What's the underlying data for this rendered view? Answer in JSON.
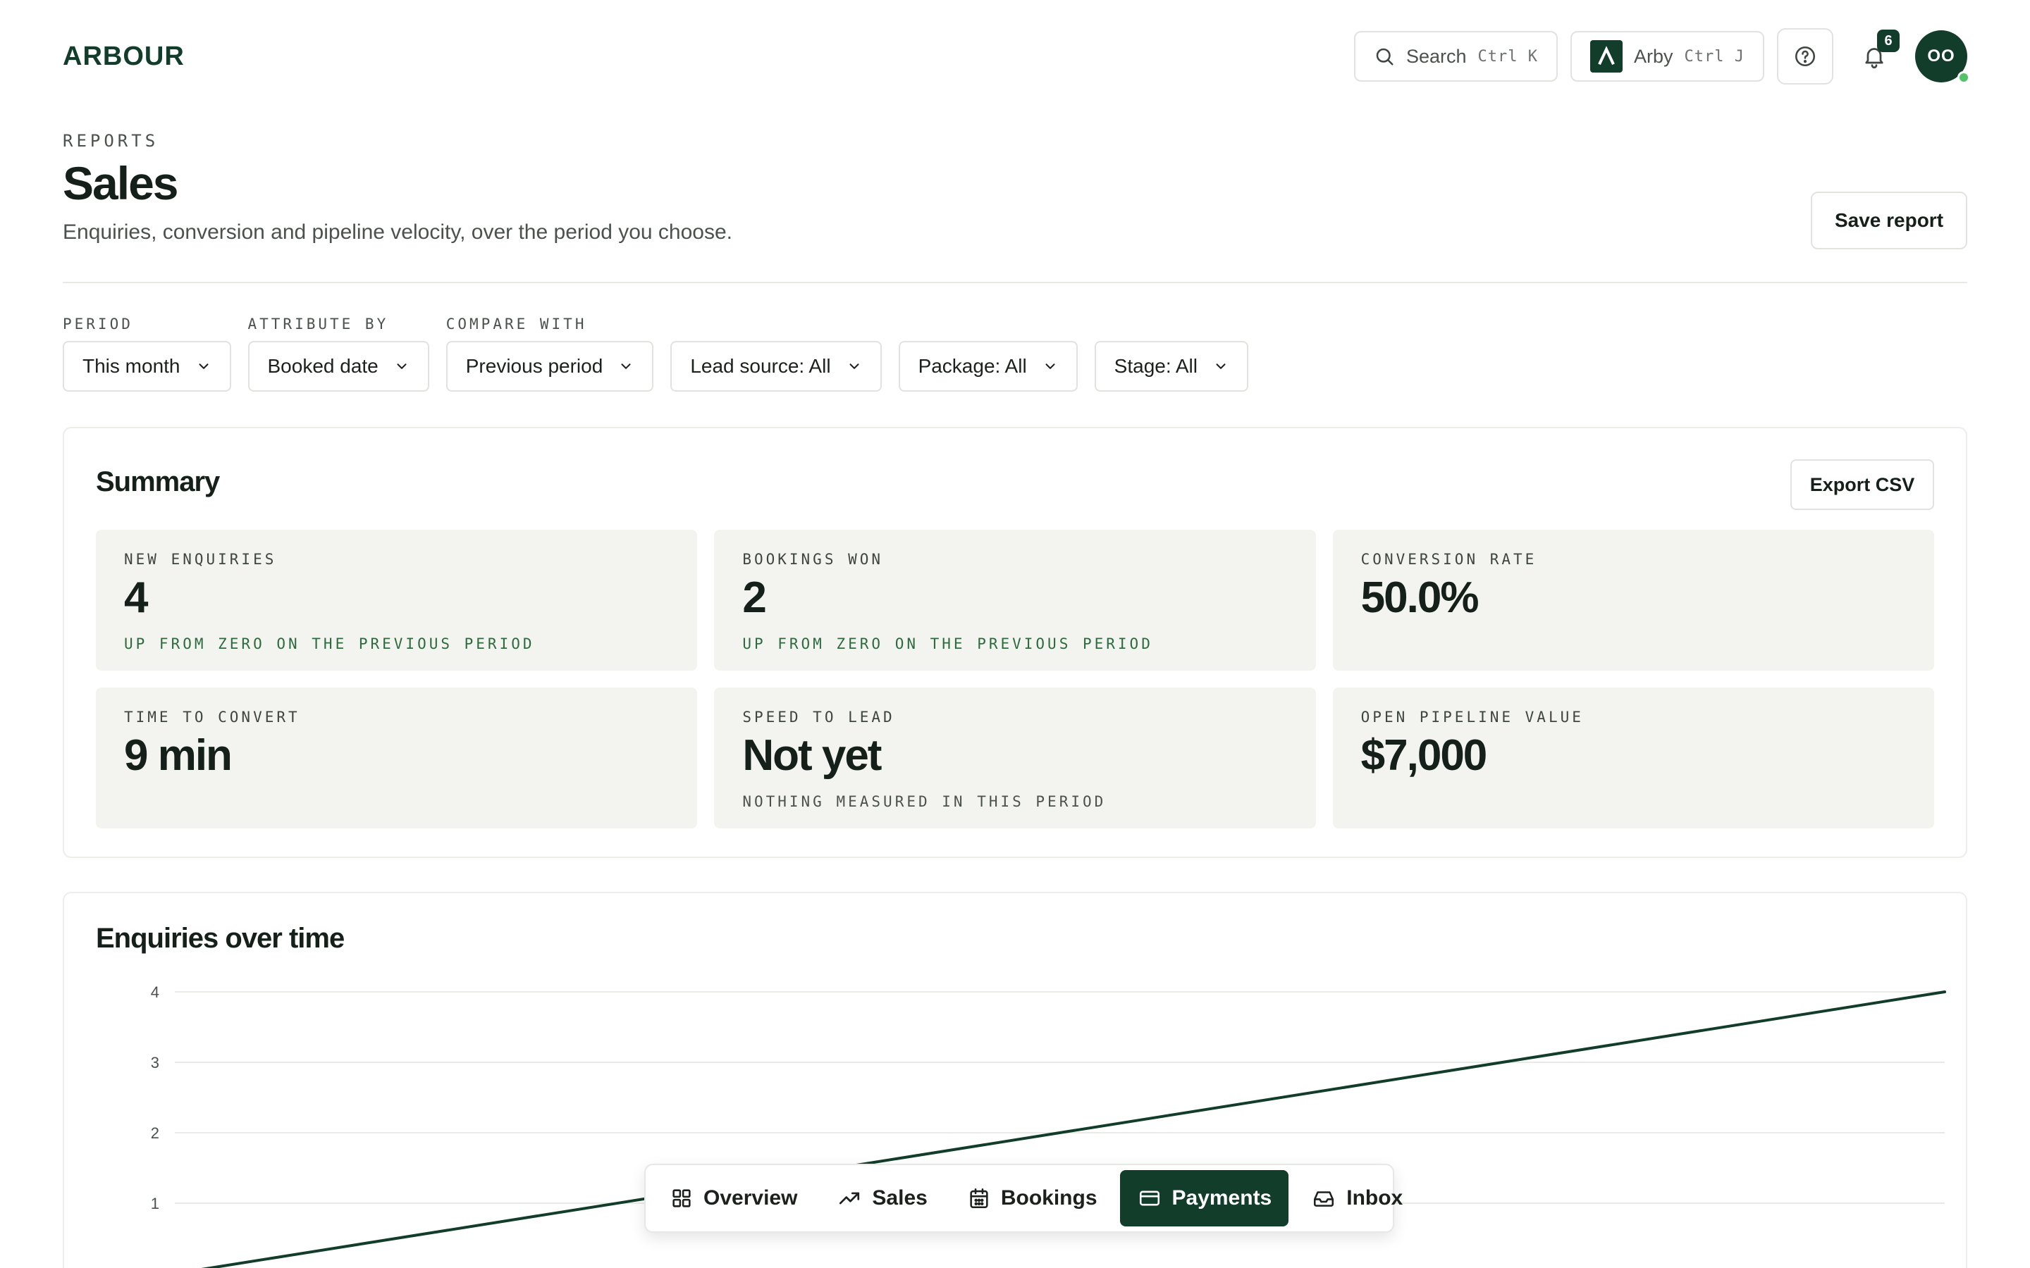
{
  "app": {
    "logo": "ARBOUR"
  },
  "header": {
    "search": {
      "label": "Search",
      "shortcut": "Ctrl K"
    },
    "assistant": {
      "label": "Arby",
      "shortcut": "Ctrl J"
    },
    "notifications_count": "6",
    "avatar_initials": "OO"
  },
  "page": {
    "eyebrow": "REPORTS",
    "title": "Sales",
    "subtitle": "Enquiries, conversion and pipeline velocity, over the period you choose.",
    "save_label": "Save report"
  },
  "filters": [
    {
      "label": "PERIOD",
      "value": "This month"
    },
    {
      "label": "ATTRIBUTE BY",
      "value": "Booked date"
    },
    {
      "label": "COMPARE WITH",
      "value": "Previous period"
    },
    {
      "label": "",
      "value": "Lead source: All"
    },
    {
      "label": "",
      "value": "Package: All"
    },
    {
      "label": "",
      "value": "Stage: All"
    }
  ],
  "summary": {
    "title": "Summary",
    "export_label": "Export CSV",
    "metrics": [
      {
        "label": "NEW ENQUIRIES",
        "value": "4",
        "note": "UP FROM ZERO ON THE PREVIOUS PERIOD"
      },
      {
        "label": "BOOKINGS WON",
        "value": "2",
        "note": "UP FROM ZERO ON THE PREVIOUS PERIOD"
      },
      {
        "label": "CONVERSION RATE",
        "value": "50.0%",
        "note": ""
      },
      {
        "label": "TIME TO CONVERT",
        "value": "9 min",
        "note": ""
      },
      {
        "label": "SPEED TO LEAD",
        "value": "Not yet",
        "note": "NOTHING MEASURED IN THIS PERIOD"
      },
      {
        "label": "OPEN PIPELINE VALUE",
        "value": "$7,000",
        "note": ""
      }
    ]
  },
  "chart": {
    "title": "Enquiries over time"
  },
  "chart_data": {
    "type": "line",
    "title": "Enquiries over time",
    "xlabel": "",
    "ylabel": "",
    "ylim": [
      0,
      4
    ],
    "yticks": [
      "0",
      "1",
      "2",
      "3",
      "4"
    ],
    "grid": true,
    "series": [
      {
        "x": [
          0,
          1
        ],
        "values": [
          0,
          4
        ],
        "color": "#123d2b"
      }
    ]
  },
  "nav": {
    "items": [
      {
        "label": "Overview",
        "icon": "grid-icon",
        "active": false
      },
      {
        "label": "Sales",
        "icon": "trend-up-icon",
        "active": false
      },
      {
        "label": "Bookings",
        "icon": "calendar-icon",
        "active": false
      },
      {
        "label": "Payments",
        "icon": "card-icon",
        "active": true
      },
      {
        "label": "Inbox",
        "icon": "inbox-icon",
        "active": false
      }
    ]
  },
  "colors": {
    "brand": "#123d2b",
    "positive": "#2d6a3e",
    "tile": "#f3f4f0",
    "online": "#53c26b"
  }
}
